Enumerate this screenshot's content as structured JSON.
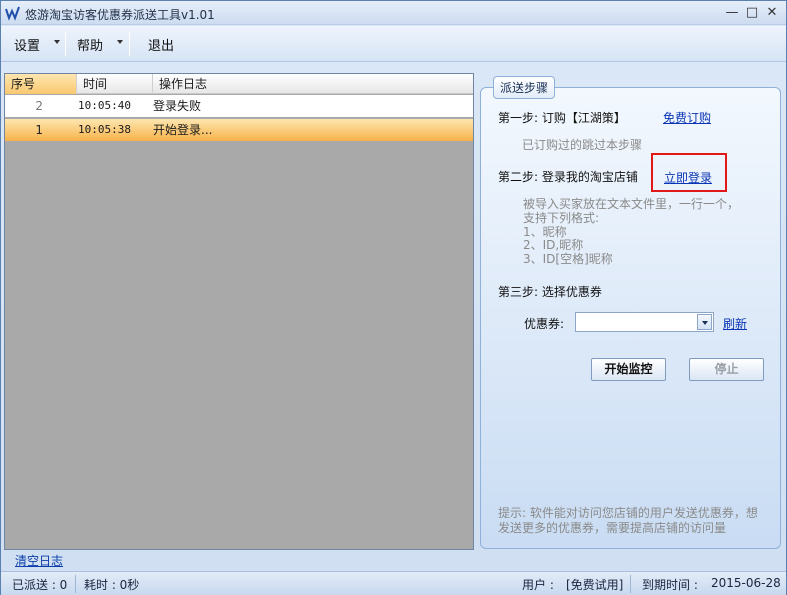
{
  "window": {
    "title": "悠游淘宝访客优惠券派送工具v1.01",
    "minimize": "—",
    "maximize": "□",
    "close": "✕"
  },
  "menu": {
    "settings": "设置",
    "help": "帮助",
    "exit": "退出"
  },
  "log": {
    "columns": [
      "序号",
      "时间",
      "操作日志"
    ],
    "rows": [
      {
        "no": "2",
        "time": "10:05:40",
        "message": "登录失败"
      },
      {
        "no": "1",
        "time": "10:05:38",
        "message": "开始登录..."
      }
    ],
    "clear_label": "清空日志"
  },
  "steps": {
    "group_title": "派送步骤",
    "step1_label": "第一步: 订购【江湖策】",
    "step1_link": "免费订购",
    "step1_hint": "已订购过的跳过本步骤",
    "step2_label": "第二步: 登录我的淘宝店铺",
    "step2_link": "立即登录",
    "import_hint_1": "被导入买家放在文本文件里，一行一个，",
    "import_hint_2": "支持下列格式:",
    "import_hint_3": "1、昵称",
    "import_hint_4": "2、ID,昵称",
    "import_hint_5": "3、ID[空格]昵称",
    "step3_label": "第三步: 选择优惠券",
    "coupon_label": "优惠券:",
    "coupon_value": "",
    "refresh_link": "刷新",
    "start_button": "开始监控",
    "stop_button": "停止",
    "tip_line_1": "提示: 软件能对访问您店铺的用户发送优惠券，想",
    "tip_line_2": "发送更多的优惠券，需要提高店铺的访问量"
  },
  "status": {
    "sent": "已派送 : 0",
    "elapsed": "耗时 : 0秒",
    "user": "用户 :",
    "user_value": "[免费试用]",
    "expire": "到期时间 :",
    "expire_value": "2015-06-28"
  },
  "colors": {
    "accent": "#0a35b5",
    "highlight_border": "#e01818",
    "selected_row": "#f6b24a"
  }
}
